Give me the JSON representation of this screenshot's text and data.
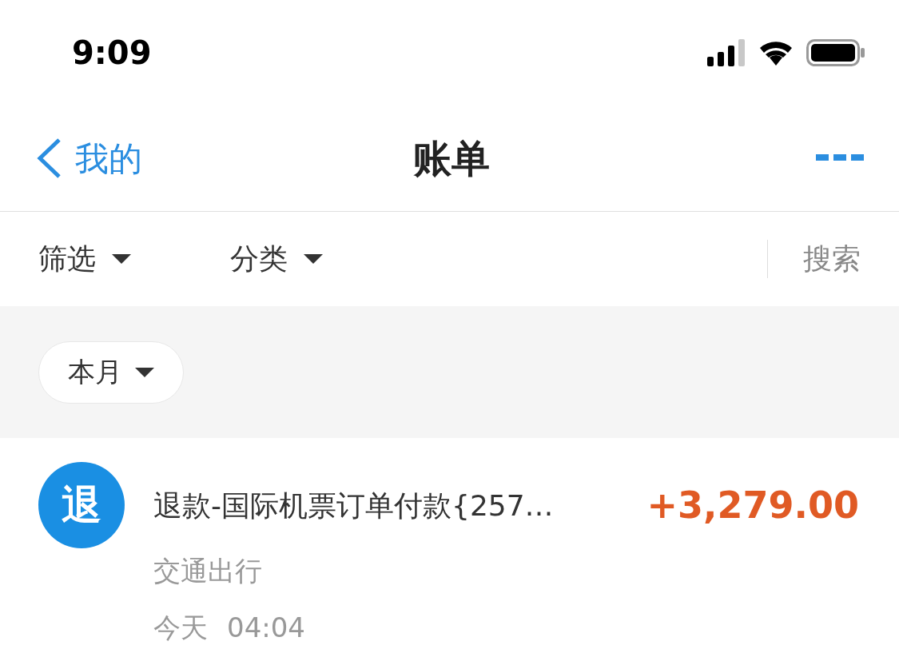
{
  "status_bar": {
    "time": "9:09"
  },
  "nav": {
    "back_label": "我的",
    "title": "账单"
  },
  "filters": [
    {
      "label": "筛选"
    },
    {
      "label": "分类"
    }
  ],
  "search": "搜索",
  "month_chip": "本月",
  "transactions": [
    {
      "icon_char": "退",
      "title": "退款-国际机票订单付款{257…",
      "category": "交通出行",
      "date": "今天",
      "time": "04:04",
      "amount": "+3,279.00"
    }
  ]
}
